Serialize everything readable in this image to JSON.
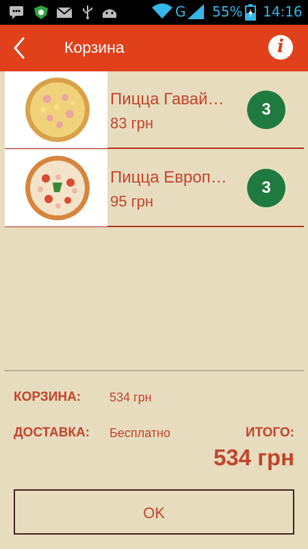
{
  "status_bar": {
    "network": "G",
    "battery": "55%",
    "time": "14:16"
  },
  "app_bar": {
    "title": "Корзина"
  },
  "cart": {
    "items": [
      {
        "name": "Пицца Гавай…",
        "price": "83 грн",
        "quantity": "3"
      },
      {
        "name": "Пицца Европ…",
        "price": "95 грн",
        "quantity": "3"
      }
    ]
  },
  "summary": {
    "cart_label": "КОРЗИНА:",
    "cart_value": "534 грн",
    "delivery_label": "ДОСТАВКА:",
    "delivery_value": "Бесплатно",
    "total_label": "ИТОГО:",
    "total_value": "534 грн"
  },
  "ok_button": {
    "label": "OK"
  },
  "colors": {
    "app_bar": "#e0401a",
    "background": "#e8dcbf",
    "accent_text": "#c0452c",
    "badge": "#1f7a40"
  }
}
